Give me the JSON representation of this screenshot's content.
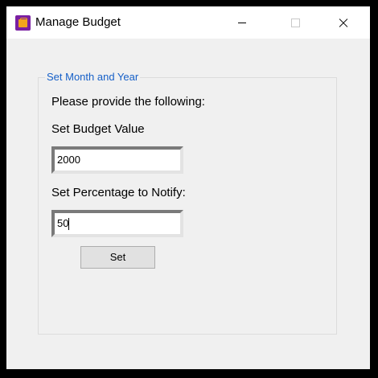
{
  "window": {
    "title": "Manage Budget"
  },
  "group": {
    "legend": "Set Month and Year",
    "instruction": "Please provide the following:",
    "budget_label": "Set Budget Value",
    "budget_value": "2000",
    "percent_label": "Set Percentage to Notify:",
    "percent_value": "50",
    "set_button_label": "Set"
  },
  "colors": {
    "legend_text": "#1660c8",
    "window_background": "#f0f0f0",
    "titlebar_background": "#ffffff"
  },
  "icons": {
    "app": "budget-app-icon",
    "minimize": "minimize-icon",
    "maximize": "maximize-icon",
    "close": "close-icon"
  }
}
